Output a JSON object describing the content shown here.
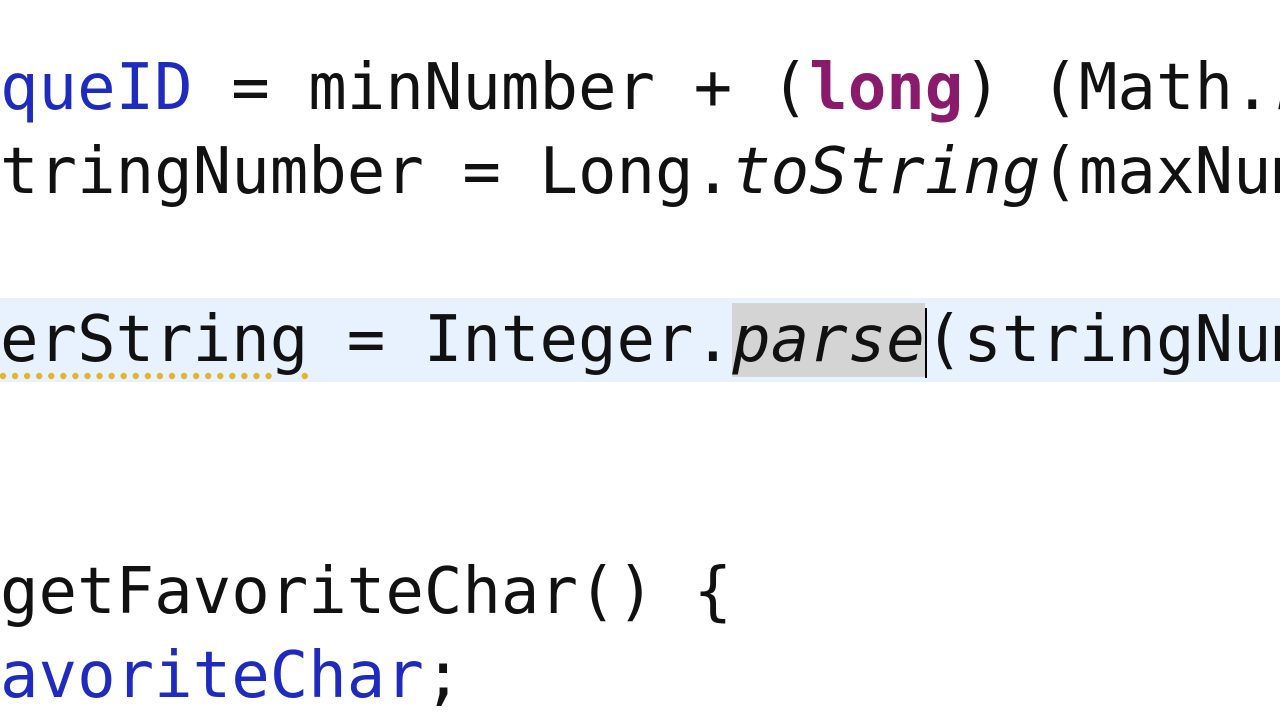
{
  "code": {
    "line1": {
      "field": "queID",
      "op1": " = minNumber + (",
      "keyword": "long",
      "op2": ") (Math.",
      "method": "ra"
    },
    "line2": {
      "prefix": "tringNumber = Long.",
      "method": "toString",
      "suffix": "(maxNumb"
    },
    "line3": {
      "var": "erString",
      "op": " = Integer.",
      "method": "parse",
      "suffix": "(stringNumb"
    },
    "line4": {
      "text": "getFavoriteChar() {"
    },
    "line5": {
      "field": "avoriteChar",
      "suffix": ";"
    }
  },
  "colors": {
    "field": "#1f2bbf",
    "keyword": "#8a1a6b",
    "current_line": "#e8f2fe",
    "selection": "#d4d4d4",
    "warning_underline": "#e2b52a"
  }
}
